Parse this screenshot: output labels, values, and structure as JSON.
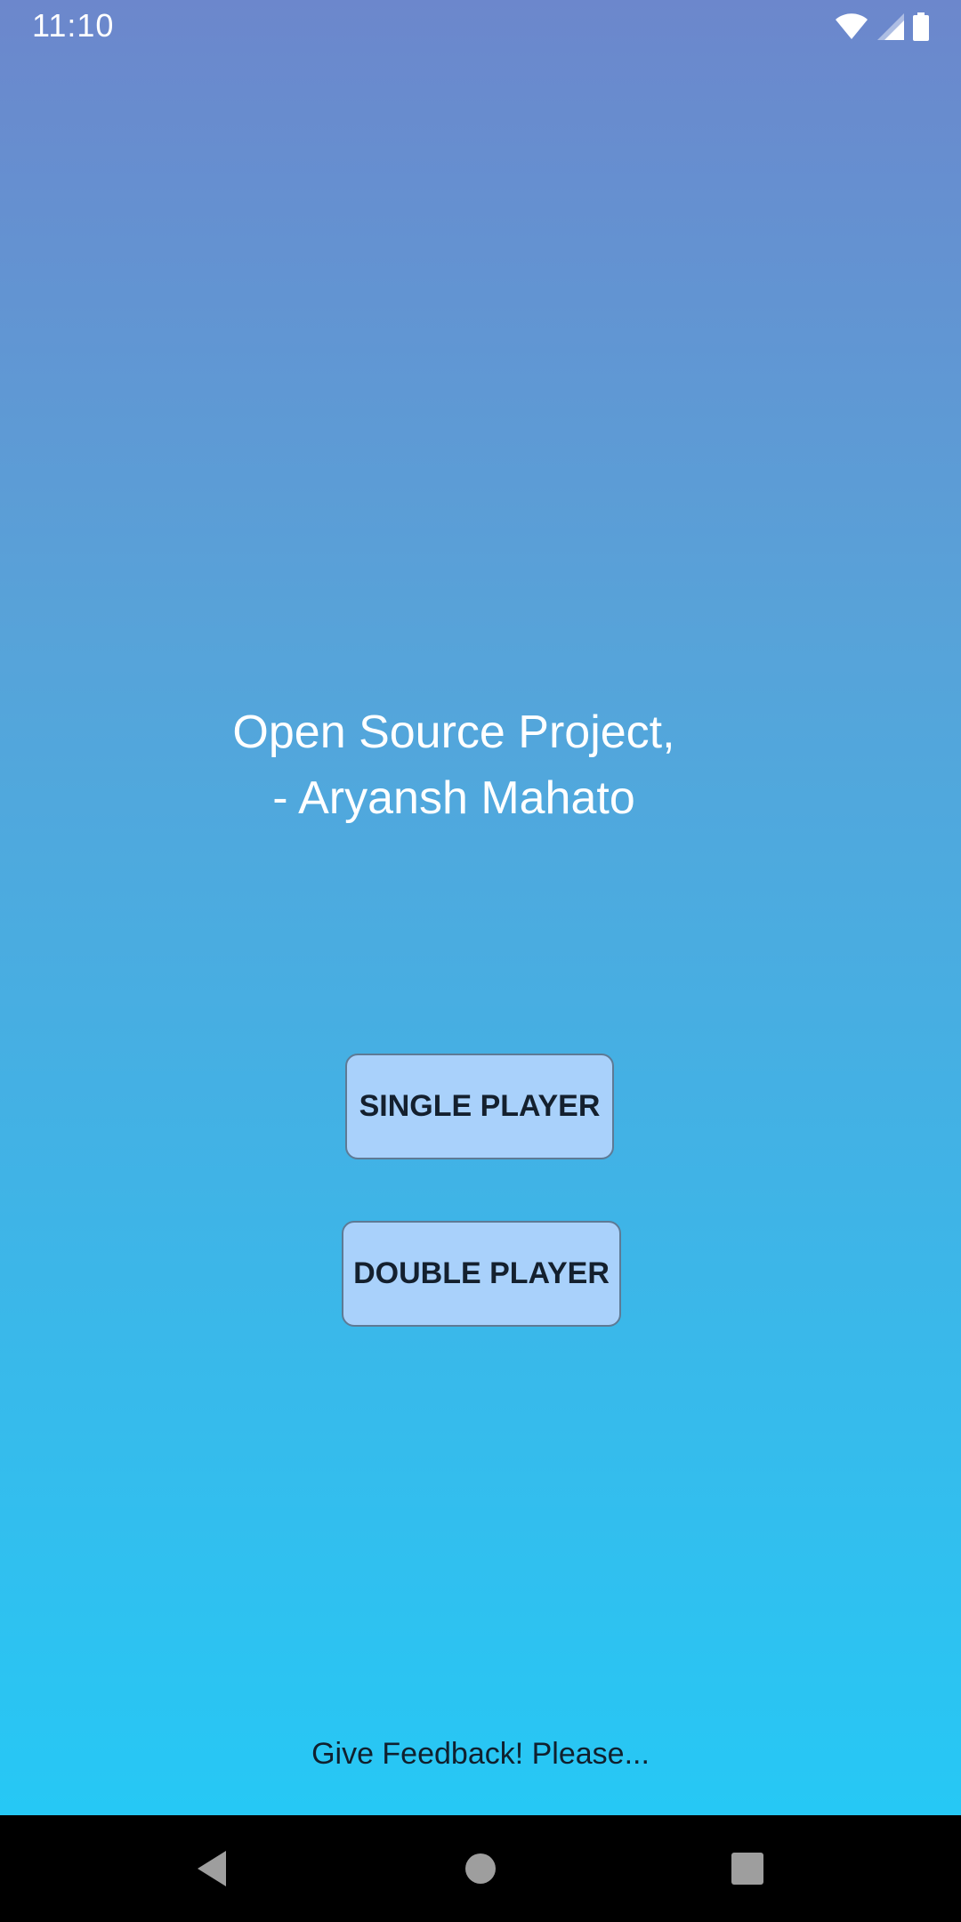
{
  "status_bar": {
    "time": "11:10",
    "icons": [
      "wifi-icon",
      "cell-signal-icon",
      "battery-icon"
    ]
  },
  "main": {
    "credit_line_1": "Open Source Project,",
    "credit_line_2": "- Aryansh Mahato",
    "single_player_label": "SINGLE PLAYER",
    "double_player_label": "DOUBLE PLAYER",
    "feedback_label": "Give Feedback! Please..."
  },
  "nav_bar": {
    "icons": [
      "back-icon",
      "home-icon",
      "recents-icon"
    ]
  },
  "colors": {
    "gradient_top": "#6C87CC",
    "gradient_bottom": "#26C8F5",
    "button_fill": "#A9D1FB",
    "button_border": "#5E7A95"
  }
}
